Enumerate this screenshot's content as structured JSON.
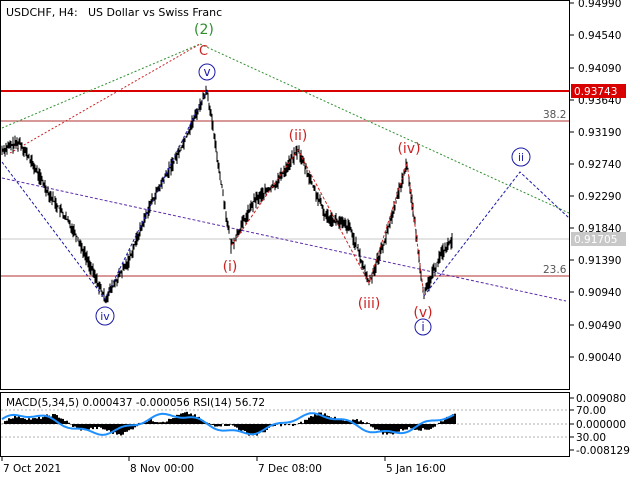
{
  "header": {
    "symbol": "USDCHF, H4:",
    "description": "US Dollar vs Swiss Franc"
  },
  "price_axis": {
    "ticks": [
      "0.94990",
      "0.94540",
      "0.94090",
      "0.93640",
      "0.93190",
      "0.92740",
      "0.92290",
      "0.91840",
      "0.91390",
      "0.90940",
      "0.90490",
      "0.90040"
    ],
    "resistance_label": "0.93743",
    "current_label": "0.91705"
  },
  "time_axis": {
    "labels": [
      "7 Oct 2021",
      "8 Nov 00:00",
      "7 Dec 08:00",
      "5 Jan 16:00"
    ]
  },
  "levels": {
    "fib_upper": "38.2",
    "fib_lower": "23.6"
  },
  "waves": {
    "w2": "(2)",
    "wc": "C",
    "wv_circle": "v",
    "wiv_circle": "iv",
    "wi_paren": "(i)",
    "wii_paren": "(ii)",
    "wiii_paren": "(iii)",
    "wiv_paren": "(iv)",
    "wv_paren": "(v)",
    "wi_circle": "i",
    "wii_circle": "ii"
  },
  "indicator": {
    "title": "MACD(5,34,5) 0.000437 -0.000056 RSI(14) 56.72",
    "ticks": [
      "0.009080",
      "70.00",
      "0.000000",
      "30.00",
      "-0.008129"
    ]
  },
  "colors": {
    "price_line": "#000000",
    "resistance": "#d90000",
    "fib": "#b03030",
    "green_wave": "#2f8f2f",
    "red_wave": "#cc2222",
    "blue_wave": "#1a1aa8",
    "rsi": "#1e8fff"
  }
}
